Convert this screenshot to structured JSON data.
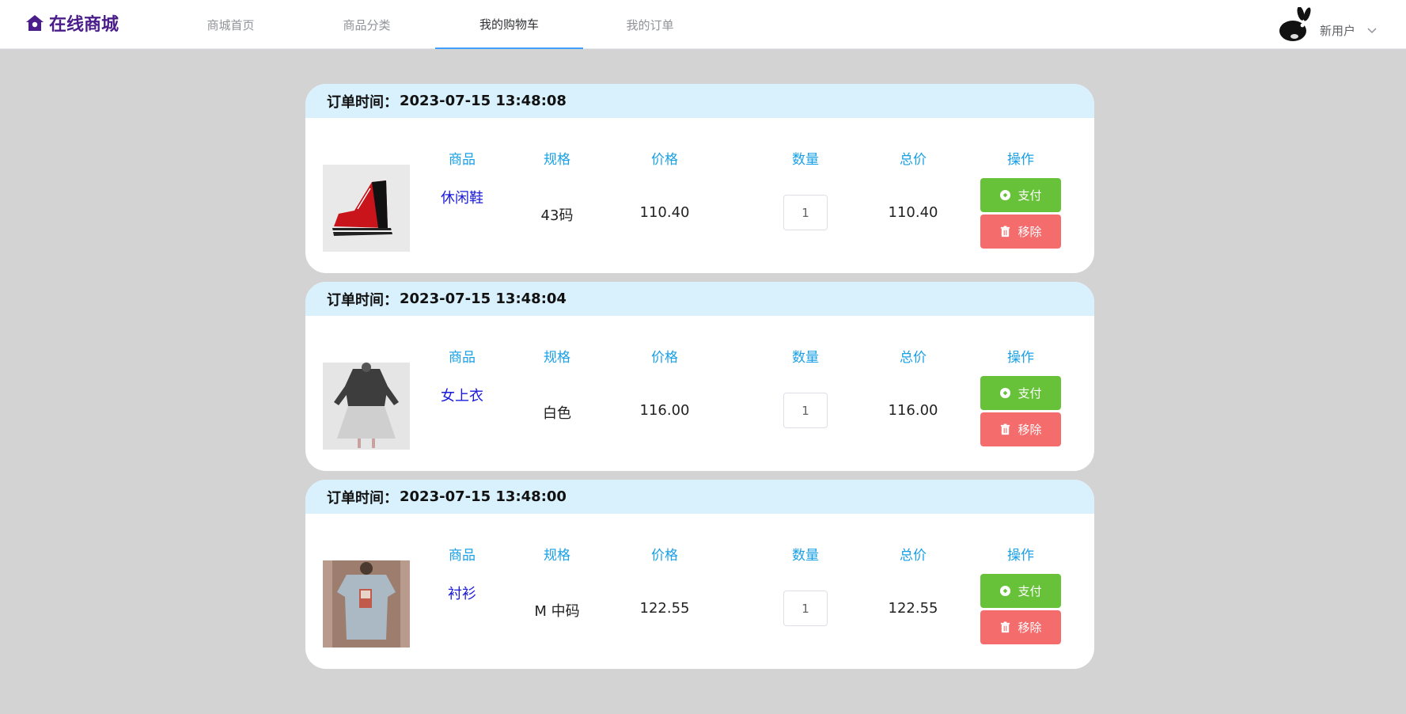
{
  "header": {
    "logo_text": "在线商城",
    "nav": [
      {
        "label": "商城首页"
      },
      {
        "label": "商品分类"
      },
      {
        "label": "我的购物车"
      },
      {
        "label": "我的订单"
      }
    ],
    "active_tab": "我的购物车",
    "user_name": "新用户"
  },
  "table_headers": {
    "product": "商品",
    "spec": "规格",
    "price": "价格",
    "qty": "数量",
    "total": "总价",
    "ops": "操作"
  },
  "order_time_label": "订单时间：",
  "orders": [
    {
      "time": "2023-07-15 13:48:08",
      "name": "休闲鞋",
      "spec": "43码",
      "price": "110.40",
      "qty": "1",
      "total": "110.40",
      "pay_label": "支付",
      "remove_label": "移除",
      "image_icon": "sneaker-image"
    },
    {
      "time": "2023-07-15 13:48:04",
      "name": "女上衣",
      "spec": "白色",
      "price": "116.00",
      "qty": "1",
      "total": "116.00",
      "pay_label": "支付",
      "remove_label": "移除",
      "image_icon": "blouse-image"
    },
    {
      "time": "2023-07-15 13:48:00",
      "name": "衬衫",
      "spec": "M 中码",
      "price": "122.55",
      "qty": "1",
      "total": "122.55",
      "pay_label": "支付",
      "remove_label": "移除",
      "image_icon": "shirt-image"
    }
  ],
  "colors": {
    "accent": "#409eff",
    "pay": "#67c23a",
    "remove": "#f56c6c",
    "header_bg": "#d9f1fd",
    "col_head": "#1aa0e6",
    "logo": "#4a1d8a"
  }
}
